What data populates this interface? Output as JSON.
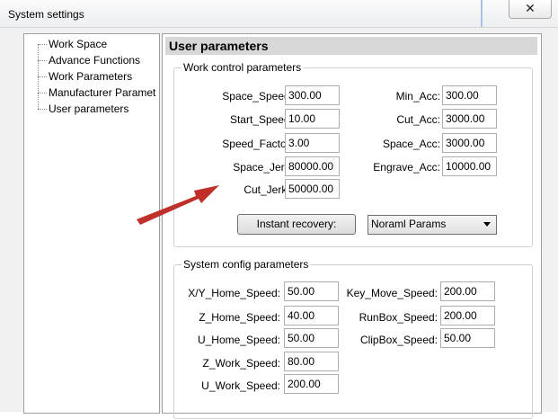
{
  "window": {
    "title": "System settings",
    "close_glyph": "✕"
  },
  "tree": {
    "items": [
      {
        "label": "Work Space"
      },
      {
        "label": "Advance Functions"
      },
      {
        "label": "Work Parameters"
      },
      {
        "label": "Manufacturer Paramet"
      },
      {
        "label": "User parameters"
      }
    ]
  },
  "panel": {
    "title": "User parameters",
    "work_group": {
      "title": "Work control parameters",
      "fields": [
        {
          "label": "Space_Speed:",
          "value": "300.00"
        },
        {
          "label": "Start_Speed:",
          "value": "10.00"
        },
        {
          "label": "Speed_Factor:",
          "value": "3.00"
        },
        {
          "label": "Space_Jerk:",
          "value": "80000.00"
        },
        {
          "label": "Cut_Jerk::",
          "value": "50000.00"
        },
        {
          "label": "Min_Acc:",
          "value": "300.00"
        },
        {
          "label": "Cut_Acc:",
          "value": "3000.00"
        },
        {
          "label": "Space_Acc:",
          "value": "3000.00"
        },
        {
          "label": "Engrave_Acc:",
          "value": "10000.00"
        }
      ],
      "recovery_button": "Instant recovery:",
      "params_select": "Noraml Params"
    },
    "config_group": {
      "title": "System config parameters",
      "fields": [
        {
          "label": "X/Y_Home_Speed:",
          "value": "50.00"
        },
        {
          "label": "Z_Home_Speed:",
          "value": "40.00"
        },
        {
          "label": "U_Home_Speed:",
          "value": "50.00"
        },
        {
          "label": "Z_Work_Speed:",
          "value": "80.00"
        },
        {
          "label": "U_Work_Speed:",
          "value": "200.00"
        },
        {
          "label": "Key_Move_Speed:",
          "value": "200.00"
        },
        {
          "label": "RunBox_Speed:",
          "value": "200.00"
        },
        {
          "label": "ClipBox_Speed:",
          "value": "50.00"
        }
      ]
    }
  },
  "colors": {
    "annotation_arrow": "#c0302a",
    "header_bg": "#d7d7d7"
  }
}
